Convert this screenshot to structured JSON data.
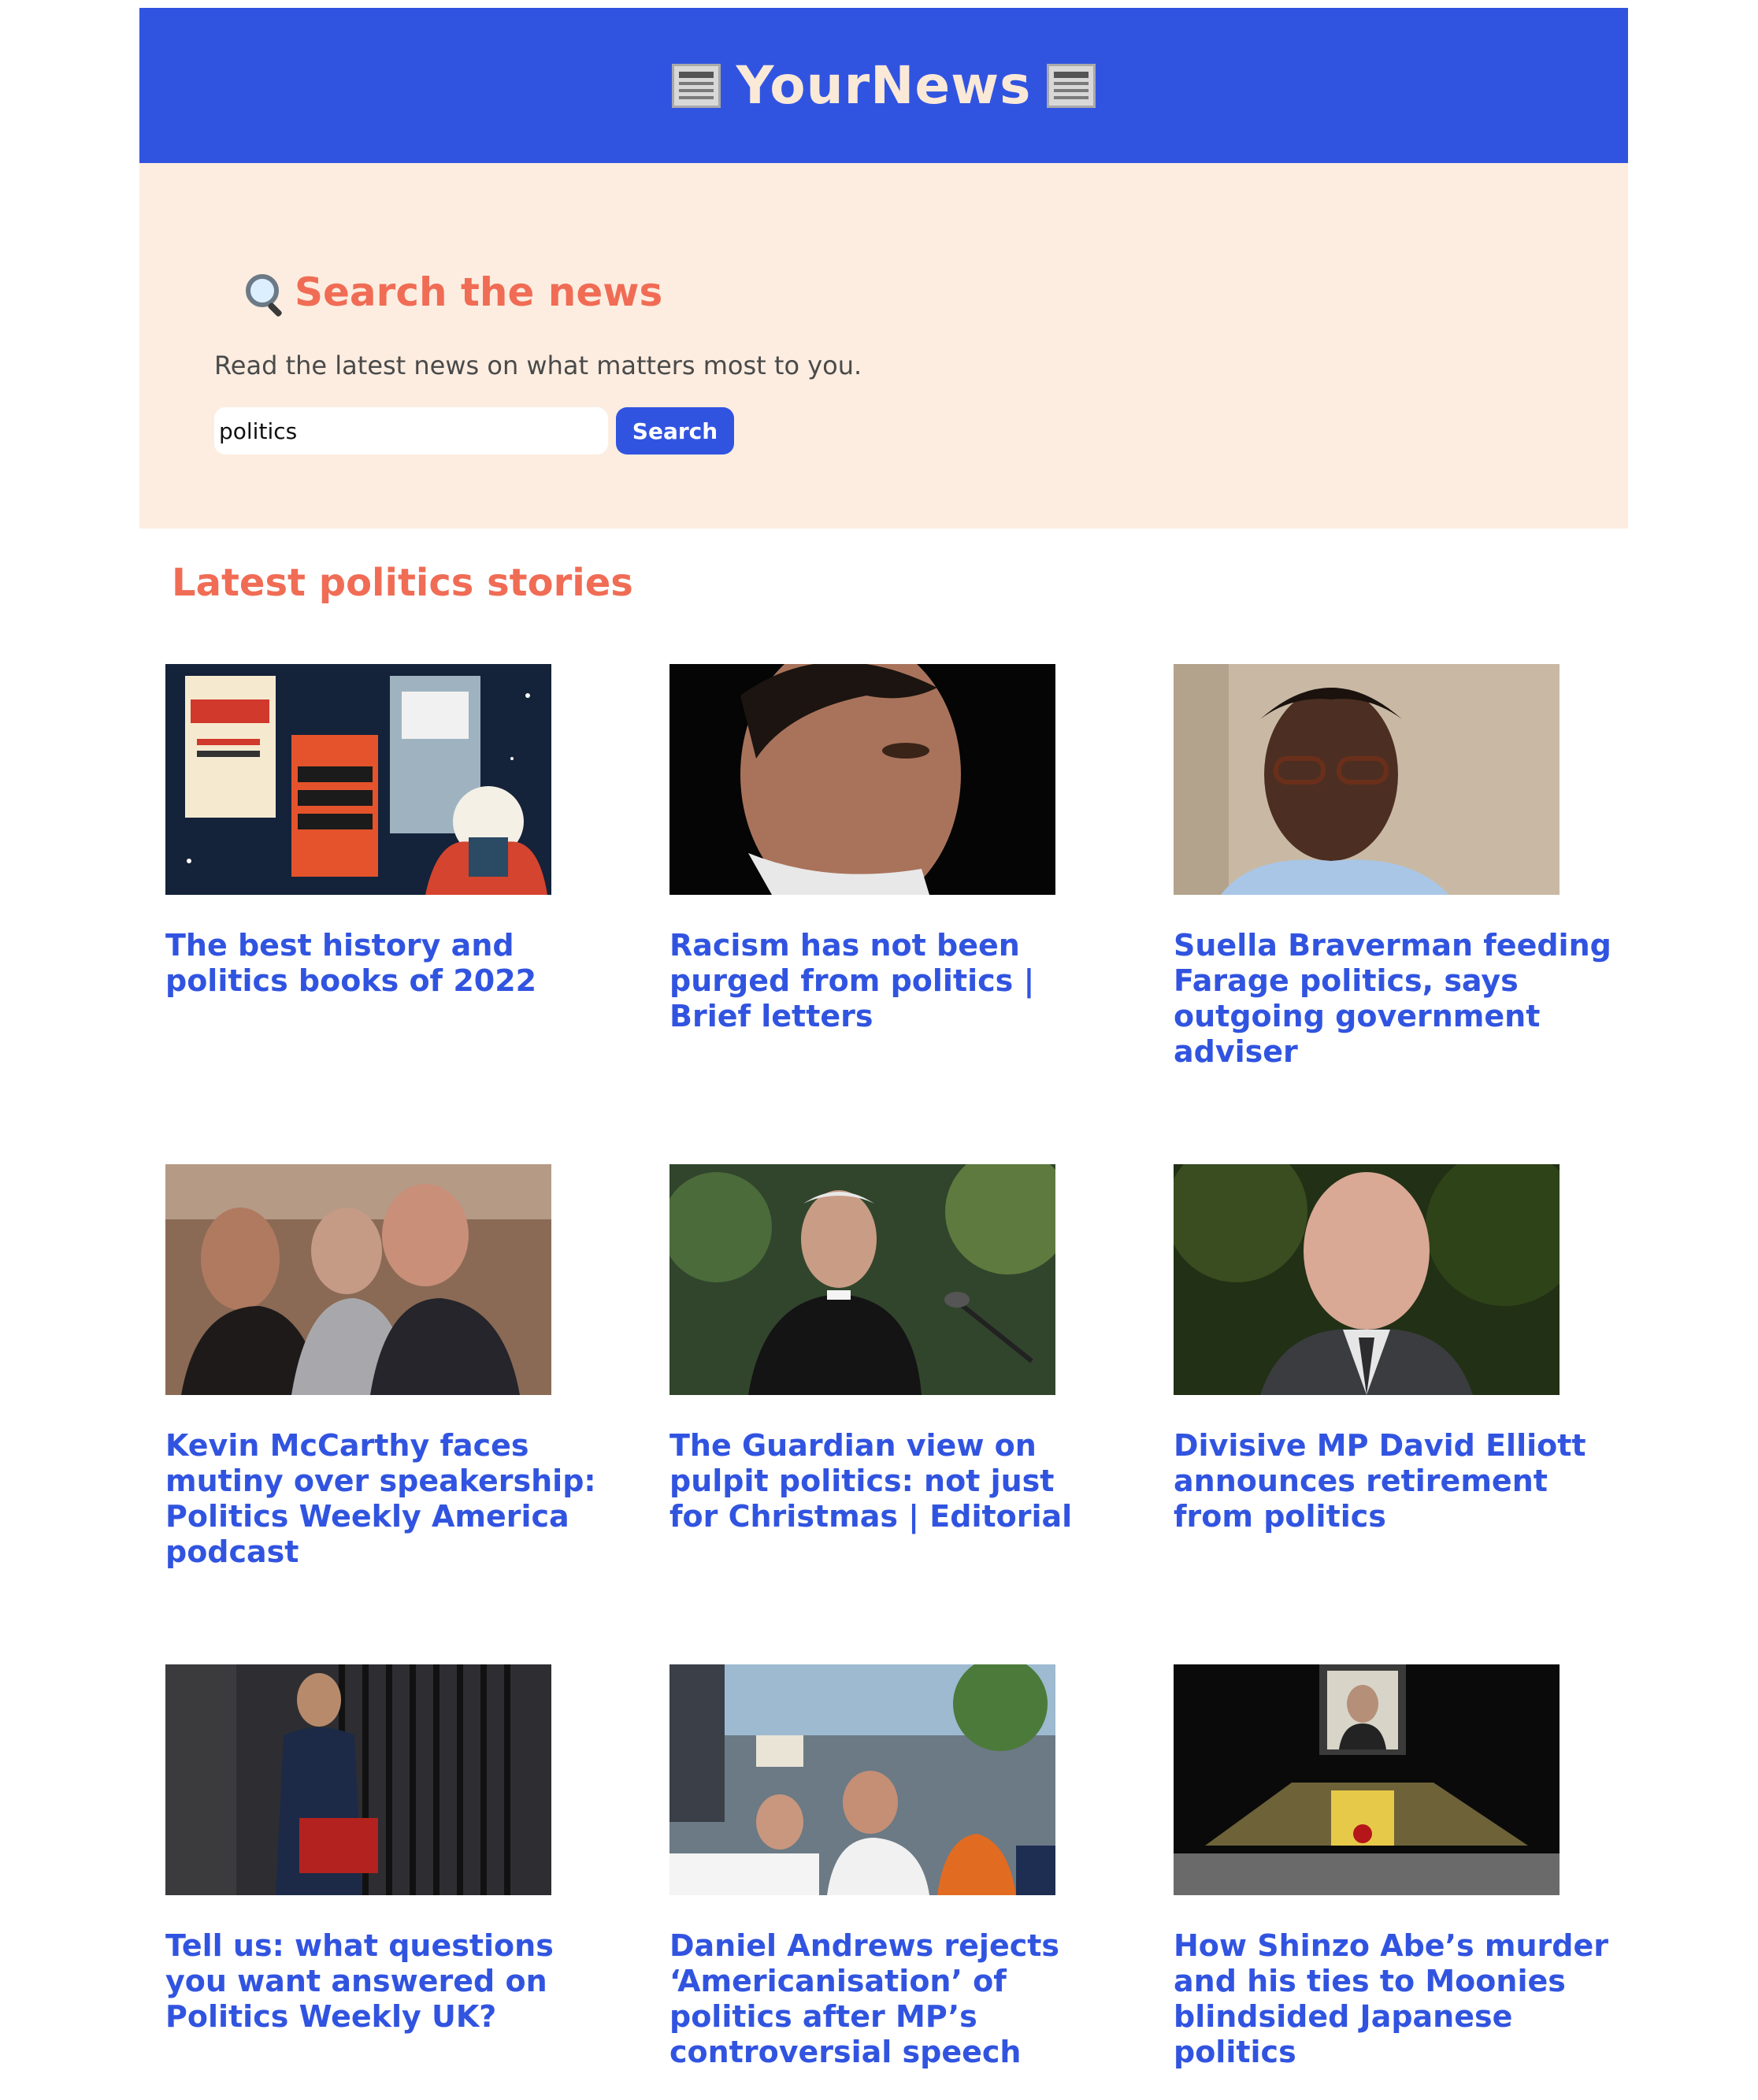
{
  "header": {
    "brand": "YourNews",
    "left_icon": "newspaper-icon",
    "right_icon": "newspaper-icon",
    "background_color": "#3154e0",
    "text_color": "#fbe9d7"
  },
  "hero": {
    "icon": "magnifying-glass-icon",
    "title": "Search the news",
    "subtitle": "Read the latest news on what matters most to you.",
    "search_value": "politics",
    "search_button": "Search",
    "background_color": "#fcede0",
    "accent_color": "#f06c55"
  },
  "section": {
    "title": "Latest politics stories"
  },
  "articles": [
    {
      "headline": "The best history and politics books of 2022",
      "image": "book-covers-illustration"
    },
    {
      "headline": "Racism has not been purged from politics | Brief letters",
      "image": "portrait-man-dark-background"
    },
    {
      "headline": "Suella Braverman feeding Farage politics, says outgoing government adviser",
      "image": "portrait-woman-glasses"
    },
    {
      "headline": "Kevin McCarthy faces mutiny over speakership: Politics Weekly America podcast",
      "image": "men-in-chamber"
    },
    {
      "headline": "The Guardian view on pulpit politics: not just for Christmas | Editorial",
      "image": "clergyman-at-microphone"
    },
    {
      "headline": "Divisive MP David Elliott announces retirement from politics",
      "image": "portrait-bald-man"
    },
    {
      "headline": "Tell us: what questions you want answered on Politics Weekly UK?",
      "image": "man-with-red-box-outside-door"
    },
    {
      "headline": "Daniel Andrews rejects ‘Americanisation’ of politics after MP’s controversial speech",
      "image": "protest-crowd"
    },
    {
      "headline": "How Shinzo Abe’s murder and his ties to Moonies blindsided Japanese politics",
      "image": "memorial-ceremony-hall"
    }
  ],
  "colors": {
    "link": "#3154e0",
    "heading": "#f06c55"
  }
}
